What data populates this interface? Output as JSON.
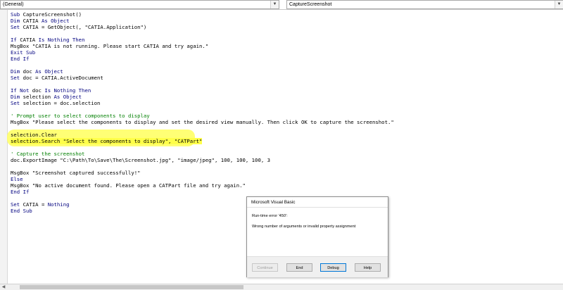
{
  "toolbar": {
    "object_combo": "(General)",
    "procedure_combo": "CaptureScreenshot",
    "dropdown_icon": "chevron-down-icon"
  },
  "code_lines": [
    {
      "segments": [
        {
          "t": "kw",
          "v": "Sub"
        },
        {
          "t": "",
          "v": " CaptureScreenshot()"
        }
      ]
    },
    {
      "segments": [
        {
          "t": "kw",
          "v": "Dim"
        },
        {
          "t": "",
          "v": " CATIA "
        },
        {
          "t": "kw",
          "v": "As Object"
        }
      ]
    },
    {
      "segments": [
        {
          "t": "kw",
          "v": "Set"
        },
        {
          "t": "",
          "v": " CATIA = GetObject(, \"CATIA.Application\")"
        }
      ]
    },
    {
      "segments": []
    },
    {
      "segments": [
        {
          "t": "kw",
          "v": "If"
        },
        {
          "t": "",
          "v": " CATIA "
        },
        {
          "t": "kw",
          "v": "Is Nothing Then"
        }
      ]
    },
    {
      "segments": [
        {
          "t": "",
          "v": "MsgBox \"CATIA is not running. Please start CATIA and try again.\""
        }
      ]
    },
    {
      "segments": [
        {
          "t": "kw",
          "v": "Exit Sub"
        }
      ]
    },
    {
      "segments": [
        {
          "t": "kw",
          "v": "End If"
        }
      ]
    },
    {
      "segments": []
    },
    {
      "segments": [
        {
          "t": "kw",
          "v": "Dim"
        },
        {
          "t": "",
          "v": " doc "
        },
        {
          "t": "kw",
          "v": "As Object"
        }
      ]
    },
    {
      "segments": [
        {
          "t": "kw",
          "v": "Set"
        },
        {
          "t": "",
          "v": " doc = CATIA.ActiveDocument"
        }
      ]
    },
    {
      "segments": []
    },
    {
      "segments": [
        {
          "t": "kw",
          "v": "If Not"
        },
        {
          "t": "",
          "v": " doc "
        },
        {
          "t": "kw",
          "v": "Is Nothing Then"
        }
      ]
    },
    {
      "segments": [
        {
          "t": "kw",
          "v": "Dim"
        },
        {
          "t": "",
          "v": " selection "
        },
        {
          "t": "kw",
          "v": "As Object"
        }
      ]
    },
    {
      "segments": [
        {
          "t": "kw",
          "v": "Set"
        },
        {
          "t": "",
          "v": " selection = doc.selection"
        }
      ]
    },
    {
      "segments": []
    },
    {
      "segments": [
        {
          "t": "cm",
          "v": "' Prompt user to select components to display"
        }
      ]
    },
    {
      "segments": [
        {
          "t": "",
          "v": "MsgBox \"Please select the components to display and set the desired view manually. Then click OK to capture the screenshot.\""
        }
      ]
    },
    {
      "segments": []
    },
    {
      "segments": [
        {
          "t": "",
          "v": "selection.Clear"
        }
      ]
    },
    {
      "segments": [
        {
          "t": "",
          "v": "selection.Search \"Select the components to display\", \"CATPart\""
        }
      ],
      "highlight": true
    },
    {
      "segments": []
    },
    {
      "segments": [
        {
          "t": "cm",
          "v": "' Capture the screenshot"
        }
      ]
    },
    {
      "segments": [
        {
          "t": "",
          "v": "doc.ExportImage \"C:\\Path\\To\\Save\\The\\Screenshot.jpg\", \"image/jpeg\", 100, 100, 100, 3"
        }
      ]
    },
    {
      "segments": []
    },
    {
      "segments": [
        {
          "t": "",
          "v": "MsgBox \"Screenshot captured successfully!\""
        }
      ]
    },
    {
      "segments": [
        {
          "t": "kw",
          "v": "Else"
        }
      ]
    },
    {
      "segments": [
        {
          "t": "",
          "v": "MsgBox \"No active document found. Please open a CATPart file and try again.\""
        }
      ]
    },
    {
      "segments": [
        {
          "t": "kw",
          "v": "End If"
        }
      ]
    },
    {
      "segments": []
    },
    {
      "segments": [
        {
          "t": "kw",
          "v": "Set"
        },
        {
          "t": "",
          "v": " CATIA = "
        },
        {
          "t": "kw",
          "v": "Nothing"
        }
      ]
    },
    {
      "segments": [
        {
          "t": "kw",
          "v": "End Sub"
        }
      ]
    }
  ],
  "colors": {
    "keyword": "#00007f",
    "comment": "#007f00",
    "highlight": "#ffff4a"
  },
  "dialog": {
    "title": "Microsoft Visual Basic",
    "error": "Run-time error '450':",
    "message": "Wrong number of arguments or invalid property assignment",
    "buttons": {
      "continue": "Continue",
      "end": "End",
      "debug": "Debug",
      "help": "Help"
    }
  },
  "scrollbar": {
    "left_arrow_icon": "chevron-left-icon"
  }
}
